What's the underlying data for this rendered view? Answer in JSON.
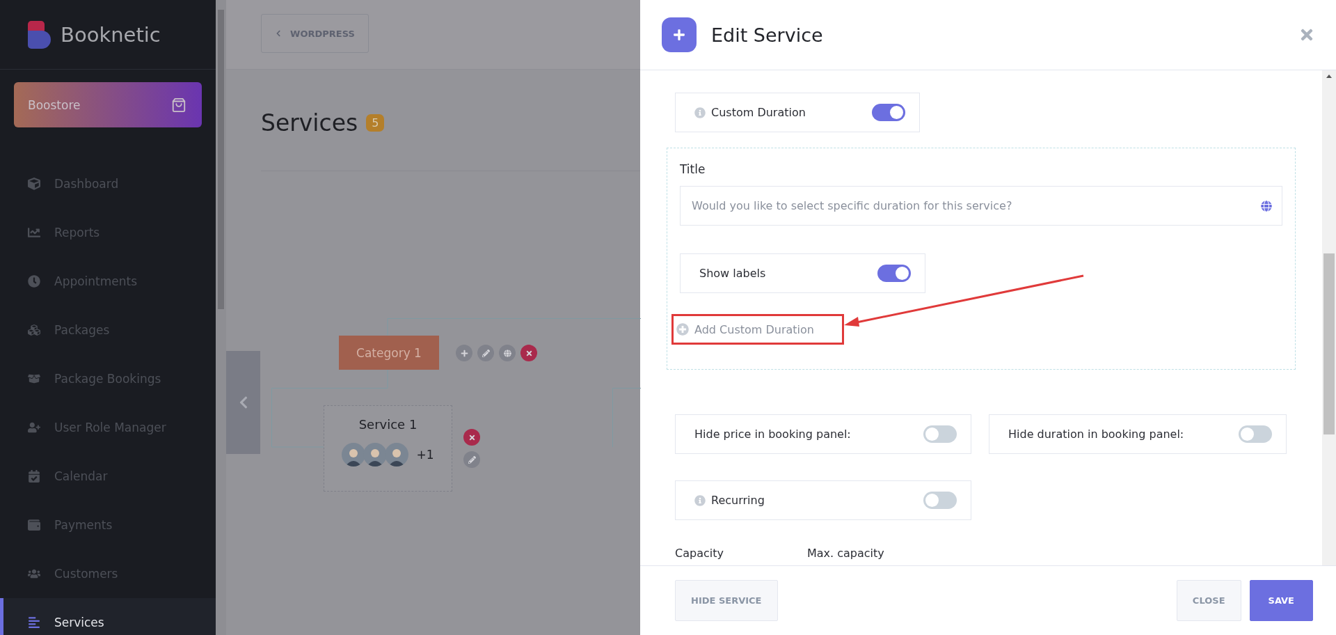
{
  "sidebar": {
    "brand": "Booknetic",
    "store_button": "Boostore",
    "items": [
      {
        "label": "Dashboard",
        "selected": false
      },
      {
        "label": "Reports",
        "selected": false
      },
      {
        "label": "Appointments",
        "selected": false
      },
      {
        "label": "Packages",
        "selected": false
      },
      {
        "label": "Package Bookings",
        "selected": false
      },
      {
        "label": "User Role Manager",
        "selected": false
      },
      {
        "label": "Calendar",
        "selected": false
      },
      {
        "label": "Payments",
        "selected": false
      },
      {
        "label": "Customers",
        "selected": false
      },
      {
        "label": "Services",
        "selected": true
      }
    ]
  },
  "page": {
    "back_button": "WORDPRESS",
    "title": "Services",
    "count": "5",
    "tree": {
      "category": "Category 1",
      "service": "Service 1",
      "staff_more": "+1"
    }
  },
  "modal": {
    "title": "Edit Service",
    "custom_duration": {
      "label": "Custom Duration",
      "info": true,
      "on": true
    },
    "title_field": {
      "label": "Title",
      "placeholder": "Would you like to select specific duration for this service?"
    },
    "show_labels": {
      "label": "Show labels",
      "on": true
    },
    "add_link": "Add Custom Duration",
    "hide_toggles": [
      {
        "label": "Hide price in booking panel:",
        "on": false
      },
      {
        "label": "Hide duration in booking panel:",
        "on": false
      }
    ],
    "recurring": {
      "label": "Recurring",
      "info": true,
      "on": false
    },
    "capacity_labels": [
      "Capacity",
      "Max. capacity"
    ],
    "footer": {
      "hide_button": "HIDE SERVICE",
      "close_button": "CLOSE",
      "save_button": "SAVE"
    }
  }
}
